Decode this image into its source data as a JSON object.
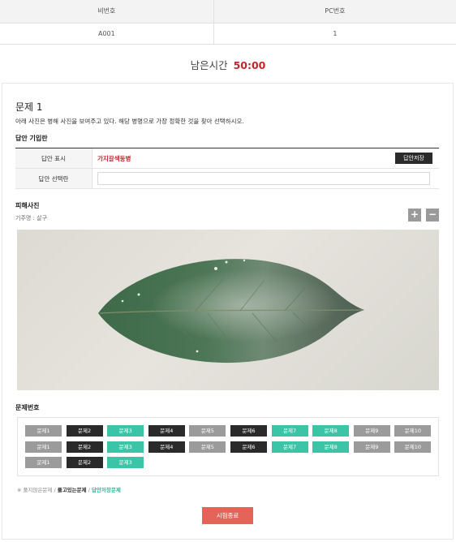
{
  "exam_info": {
    "headers": [
      "비번호",
      "PC번호"
    ],
    "values": [
      "A001",
      "1"
    ]
  },
  "timer": {
    "label": "남은시간",
    "value": "50:00"
  },
  "question": {
    "title": "문제 1",
    "description": "아래 사진은 병해 사진을 보여주고 있다. 해당 병명으로 가장 정확한 것을 찾아 선택하시오."
  },
  "answer_section": {
    "heading": "답안 기입란",
    "display_label": "답안 표시",
    "display_value": "가지갈색둥병",
    "save_label": "답안저장",
    "select_label": "답안 선택란",
    "select_value": ""
  },
  "photo_section": {
    "heading": "피해사진",
    "host_label": "기주명 : 살구",
    "zoom_in": "+",
    "zoom_out": "−"
  },
  "question_numbers": {
    "heading": "문제번호",
    "rows": [
      [
        {
          "label": "문제1",
          "state": "gray"
        },
        {
          "label": "문제2",
          "state": "dark"
        },
        {
          "label": "문제3",
          "state": "teal"
        },
        {
          "label": "문제4",
          "state": "dark"
        },
        {
          "label": "문제5",
          "state": "gray"
        },
        {
          "label": "문제6",
          "state": "dark"
        },
        {
          "label": "문제7",
          "state": "teal"
        },
        {
          "label": "문제8",
          "state": "teal"
        },
        {
          "label": "문제9",
          "state": "gray"
        },
        {
          "label": "문제10",
          "state": "gray"
        }
      ],
      [
        {
          "label": "문제1",
          "state": "gray"
        },
        {
          "label": "문제2",
          "state": "dark"
        },
        {
          "label": "문제3",
          "state": "teal"
        },
        {
          "label": "문제4",
          "state": "dark"
        },
        {
          "label": "문제5",
          "state": "gray"
        },
        {
          "label": "문제6",
          "state": "dark"
        },
        {
          "label": "문제7",
          "state": "teal"
        },
        {
          "label": "문제8",
          "state": "teal"
        },
        {
          "label": "문제9",
          "state": "gray"
        },
        {
          "label": "문제10",
          "state": "gray"
        }
      ],
      [
        {
          "label": "문제1",
          "state": "gray"
        },
        {
          "label": "문제2",
          "state": "dark"
        },
        {
          "label": "문제3",
          "state": "teal"
        }
      ]
    ]
  },
  "legend": {
    "unsolved": "※ 풀지않은문제",
    "sep1": " / ",
    "solving": "풀고있는문제",
    "sep2": " / ",
    "saved": "답안저장문제"
  },
  "end_button": "시험종료",
  "colors": {
    "accent_red": "#c0272d",
    "teal": "#3cc4a6",
    "dark": "#2a2a2a",
    "gray": "#9b9b9b",
    "end": "#e4645a"
  }
}
